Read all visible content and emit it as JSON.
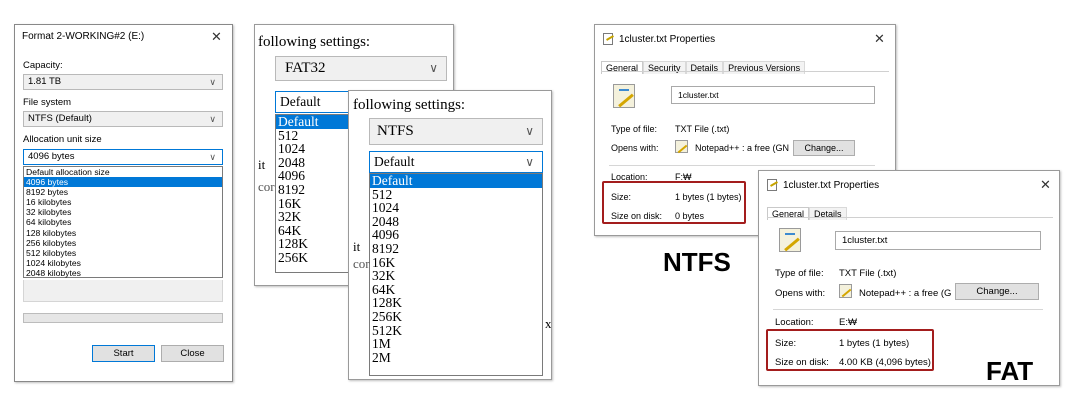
{
  "format_dialog": {
    "title": "Format 2-WORKING#2 (E:)",
    "close_glyph": "✕",
    "capacity_label": "Capacity:",
    "capacity_value": "1.81 TB",
    "filesystem_label": "File system",
    "filesystem_value": "NTFS (Default)",
    "alloc_label": "Allocation unit size",
    "alloc_value": "4096 bytes",
    "alloc_options": [
      "Default allocation size",
      "4096 bytes",
      "8192 bytes",
      "16 kilobytes",
      "32 kilobytes",
      "64 kilobytes",
      "128 kilobytes",
      "256 kilobytes",
      "512 kilobytes",
      "1024 kilobytes",
      "2048 kilobytes"
    ],
    "alloc_selected_index": 1,
    "start_label": "Start",
    "close_label": "Close"
  },
  "fat32_dialog": {
    "header": "following settings:",
    "filesystem_value": "FAT32",
    "alloc_value": "Default",
    "alloc_options": [
      "Default",
      "512",
      "1024",
      "2048",
      "4096",
      "8192",
      "16K",
      "32K",
      "64K",
      "128K",
      "256K"
    ],
    "alloc_selected_index": 0,
    "clipped_labels": [
      "it",
      "cor"
    ]
  },
  "ntfs_dialog": {
    "header": "following settings:",
    "filesystem_value": "NTFS",
    "alloc_value": "Default",
    "alloc_options": [
      "Default",
      "512",
      "1024",
      "2048",
      "4096",
      "8192",
      "16K",
      "32K",
      "64K",
      "128K",
      "256K",
      "512K",
      "1M",
      "2M"
    ],
    "alloc_selected_index": 0,
    "clipped_labels": [
      "it",
      "cor",
      "x"
    ]
  },
  "props_ntfs": {
    "title": "1cluster.txt Properties",
    "close_glyph": "✕",
    "tabs": [
      "General",
      "Security",
      "Details",
      "Previous Versions"
    ],
    "filename": "1cluster.txt",
    "type_label": "Type of file:",
    "type_value": "TXT File (.txt)",
    "opens_label": "Opens with:",
    "opens_value": "Notepad++ : a free (GN",
    "change_label": "Change...",
    "location_label": "Location:",
    "location_value": "F:₩",
    "size_label": "Size:",
    "size_value": "1 bytes (1 bytes)",
    "disk_label": "Size on disk:",
    "disk_value": "0 bytes"
  },
  "props_fat": {
    "title": "1cluster.txt Properties",
    "close_glyph": "✕",
    "tabs": [
      "General",
      "Details"
    ],
    "filename": "1cluster.txt",
    "type_label": "Type of file:",
    "type_value": "TXT File (.txt)",
    "opens_label": "Opens with:",
    "opens_value": "Notepad++ : a free (G",
    "change_label": "Change...",
    "location_label": "Location:",
    "location_value": "E:₩",
    "size_label": "Size:",
    "size_value": "1 bytes (1 bytes)",
    "disk_label": "Size on disk:",
    "disk_value": "4.00 KB (4,096 bytes)"
  },
  "captions": {
    "ntfs": "NTFS",
    "fat": "FAT"
  },
  "icons": {
    "chevron": "chevron-down-icon",
    "file": "text-file-icon",
    "notepad": "notepad-icon"
  }
}
